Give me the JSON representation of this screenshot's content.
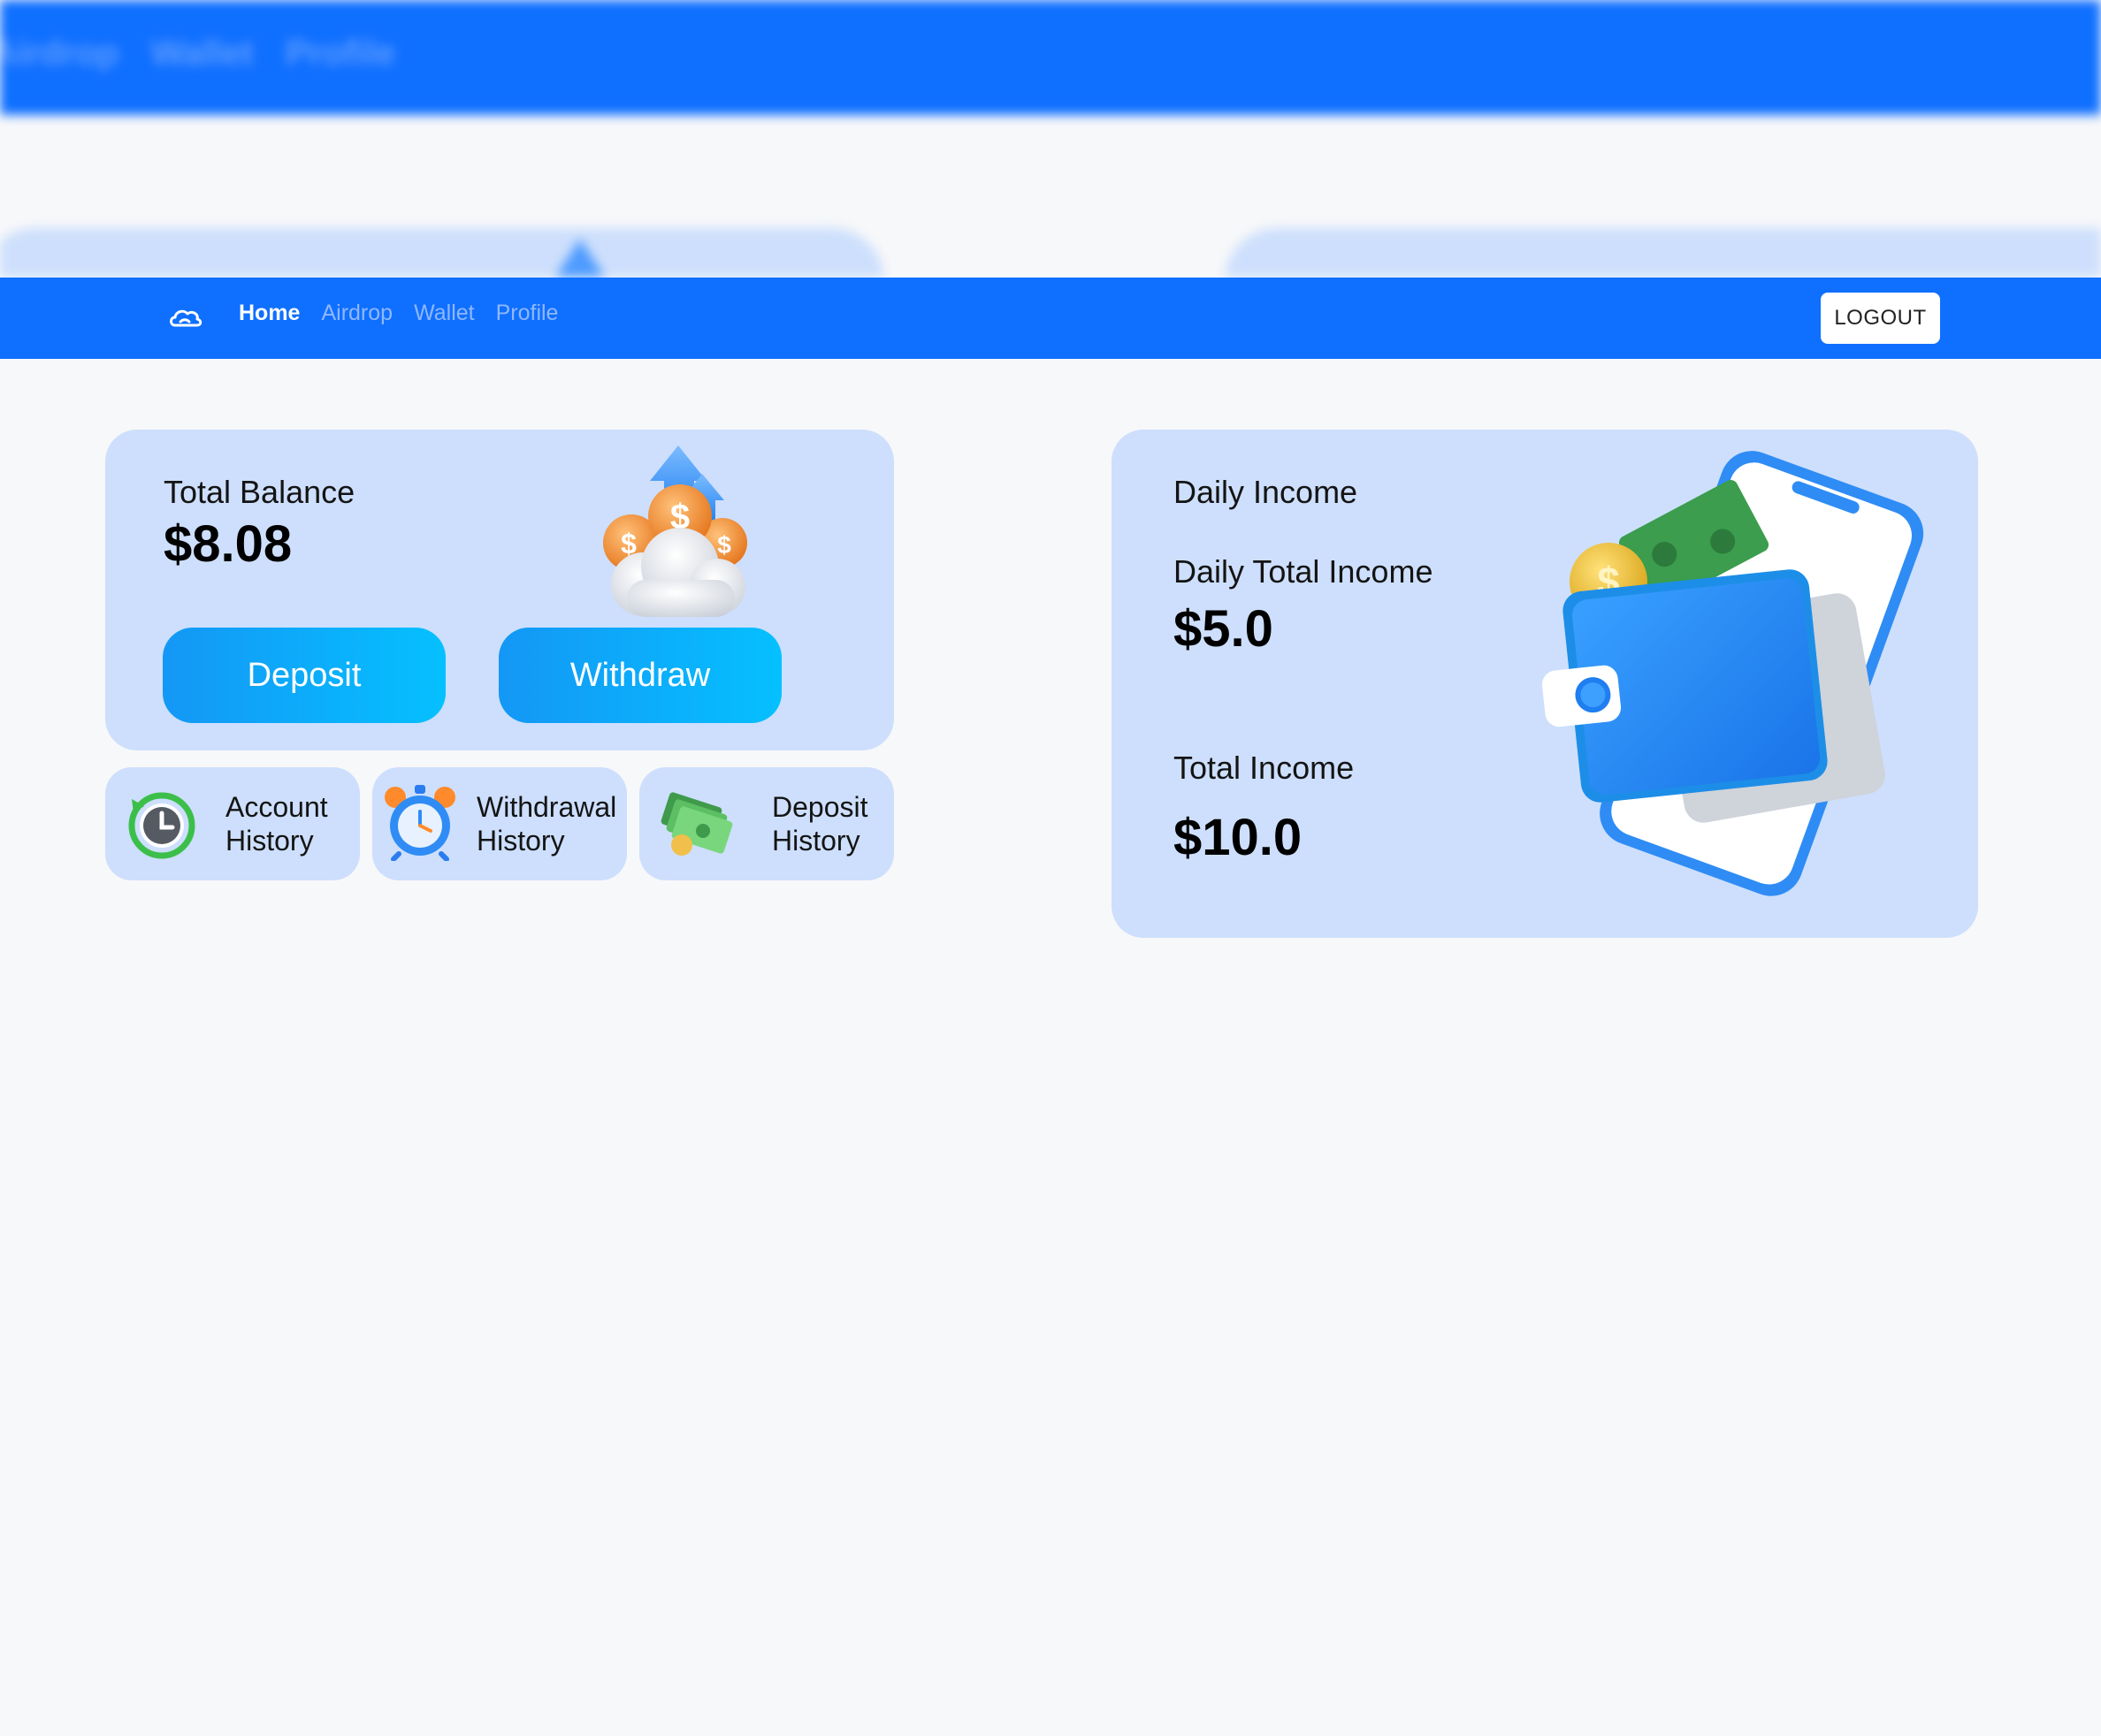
{
  "background_nav": {
    "items": [
      "Airdrop",
      "Wallet",
      "Profile"
    ]
  },
  "nav": {
    "brand_icon": "cloud-icon",
    "links": [
      "Home",
      "Airdrop",
      "Wallet",
      "Profile"
    ],
    "active": "Home",
    "logout_label": "LOGOUT"
  },
  "balance": {
    "title": "Total Balance",
    "amount": "$8.08",
    "deposit_label": "Deposit",
    "withdraw_label": "Withdraw"
  },
  "history": [
    {
      "label_line1": "Account",
      "label_line2": "History",
      "icon": "clock-history-icon"
    },
    {
      "label_line1": "Withdrawal",
      "label_line2": "History",
      "icon": "alarm-clock-icon"
    },
    {
      "label_line1": "Deposit",
      "label_line2": "History",
      "icon": "cash-icon"
    }
  ],
  "income": {
    "title": "Daily Income",
    "daily_total_label": "Daily Total Income",
    "daily_total_value": "$5.0",
    "total_label": "Total Income",
    "total_value": "$10.0"
  },
  "colors": {
    "primary": "#0f6fff",
    "card": "#cddffc",
    "button_start": "#1497f5",
    "button_end": "#05c0ff",
    "page_bg": "#f7f8fa"
  }
}
